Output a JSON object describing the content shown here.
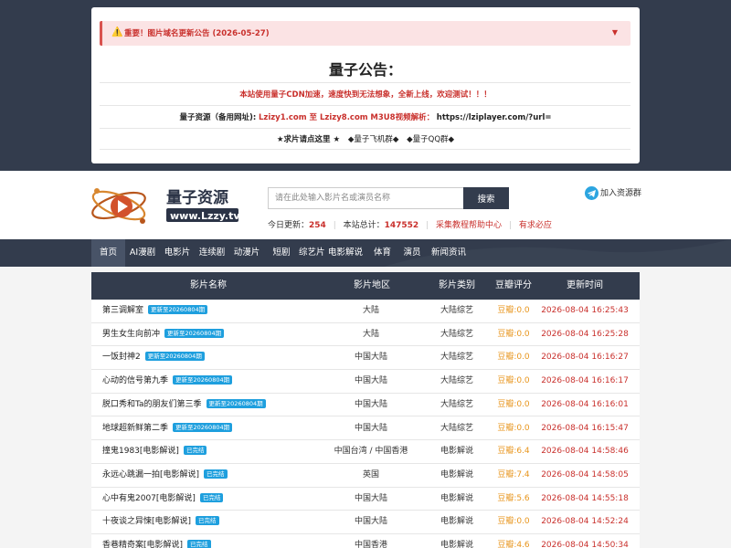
{
  "notice": {
    "alert_icon": "⚠️",
    "alert_text": "重要！图片域名更新公告 (2026-05-27)",
    "alert_toggle": "▼",
    "title": "量子公告：",
    "cdn_line": "本站使用量子CDN加速，速度快到无法想象，全新上线，欢迎测试！！！",
    "resource_label": "量子资源（备用网址):",
    "resource_domains": "Lzizy1.com 至 Lzizy8.com",
    "resource_parse": "M3U8视频解析：",
    "resource_url": "https://lziplayer.com/?url=",
    "request_link": "★求片请点这里 ★",
    "group_telegram": "◆量子飞机群◆",
    "group_qq": "◆量子QQ群◆"
  },
  "header": {
    "logo_title": "量子资源",
    "logo_url": "www.Lzzy.tv",
    "search_placeholder": "请在此处输入影片名或演员名称",
    "search_button": "搜索",
    "stats": {
      "today_label": "今日更新：",
      "today_value": "254",
      "total_label": "本站总计：",
      "total_value": "147552",
      "sep": "|",
      "link_help": "采集教程帮助中心",
      "link_request": "有求必应"
    },
    "join_label": "加入资源群"
  },
  "nav": [
    {
      "label": "首页",
      "active": true
    },
    {
      "label": "AI漫剧"
    },
    {
      "label": "电影片"
    },
    {
      "label": "连续剧"
    },
    {
      "label": "动漫片"
    },
    {
      "label": "短剧"
    },
    {
      "label": "综艺片"
    },
    {
      "label": "电影解说"
    },
    {
      "label": "体育"
    },
    {
      "label": "演员"
    },
    {
      "label": "新闻资讯"
    }
  ],
  "table": {
    "headers": [
      "影片名称",
      "影片地区",
      "影片类别",
      "豆瓣评分",
      "更新时间"
    ],
    "rows": [
      {
        "name": "第三调解室",
        "badge": "更新至20260804期",
        "region": "大陆",
        "type": "大陆综艺",
        "score": "豆瓣:0.0",
        "time": "2026-08-04 16:25:43"
      },
      {
        "name": "男生女生向前冲",
        "badge": "更新至20260804期",
        "region": "大陆",
        "type": "大陆综艺",
        "score": "豆瓣:0.0",
        "time": "2026-08-04 16:25:28"
      },
      {
        "name": "一饭封神2",
        "badge": "更新至20260804期",
        "region": "中国大陆",
        "type": "大陆综艺",
        "score": "豆瓣:0.0",
        "time": "2026-08-04 16:16:27"
      },
      {
        "name": "心动的信号第九季",
        "badge": "更新至20260804期",
        "region": "中国大陆",
        "type": "大陆综艺",
        "score": "豆瓣:0.0",
        "time": "2026-08-04 16:16:17"
      },
      {
        "name": "脱口秀和Ta的朋友们第三季",
        "badge": "更新至20260804期",
        "region": "中国大陆",
        "type": "大陆综艺",
        "score": "豆瓣:0.0",
        "time": "2026-08-04 16:16:01"
      },
      {
        "name": "地球超新鲜第二季",
        "badge": "更新至20260804期",
        "region": "中国大陆",
        "type": "大陆综艺",
        "score": "豆瓣:0.0",
        "time": "2026-08-04 16:15:47"
      },
      {
        "name": "撞鬼1983[电影解说]",
        "badge": "已完结",
        "region": "中国台湾 / 中国香港",
        "type": "电影解说",
        "score": "豆瓣:6.4",
        "time": "2026-08-04 14:58:46"
      },
      {
        "name": "永远心跳漏一拍[电影解说]",
        "badge": "已完结",
        "region": "英国",
        "type": "电影解说",
        "score": "豆瓣:7.4",
        "time": "2026-08-04 14:58:05"
      },
      {
        "name": "心中有鬼2007[电影解说]",
        "badge": "已完结",
        "region": "中国大陆",
        "type": "电影解说",
        "score": "豆瓣:5.6",
        "time": "2026-08-04 14:55:18"
      },
      {
        "name": "十夜谈之异悚[电影解说]",
        "badge": "已完结",
        "region": "中国大陆",
        "type": "电影解说",
        "score": "豆瓣:0.0",
        "time": "2026-08-04 14:52:24"
      },
      {
        "name": "香巷精奇案[电影解说]",
        "badge": "已完结",
        "region": "中国香港",
        "type": "电影解说",
        "score": "豆瓣:4.6",
        "time": "2026-08-04 14:50:34"
      }
    ]
  },
  "colors": {
    "dark_bg": "#333c4d",
    "accent_red": "#c9302c",
    "badge_blue": "#1e9fde",
    "score_orange": "#e8951c"
  }
}
